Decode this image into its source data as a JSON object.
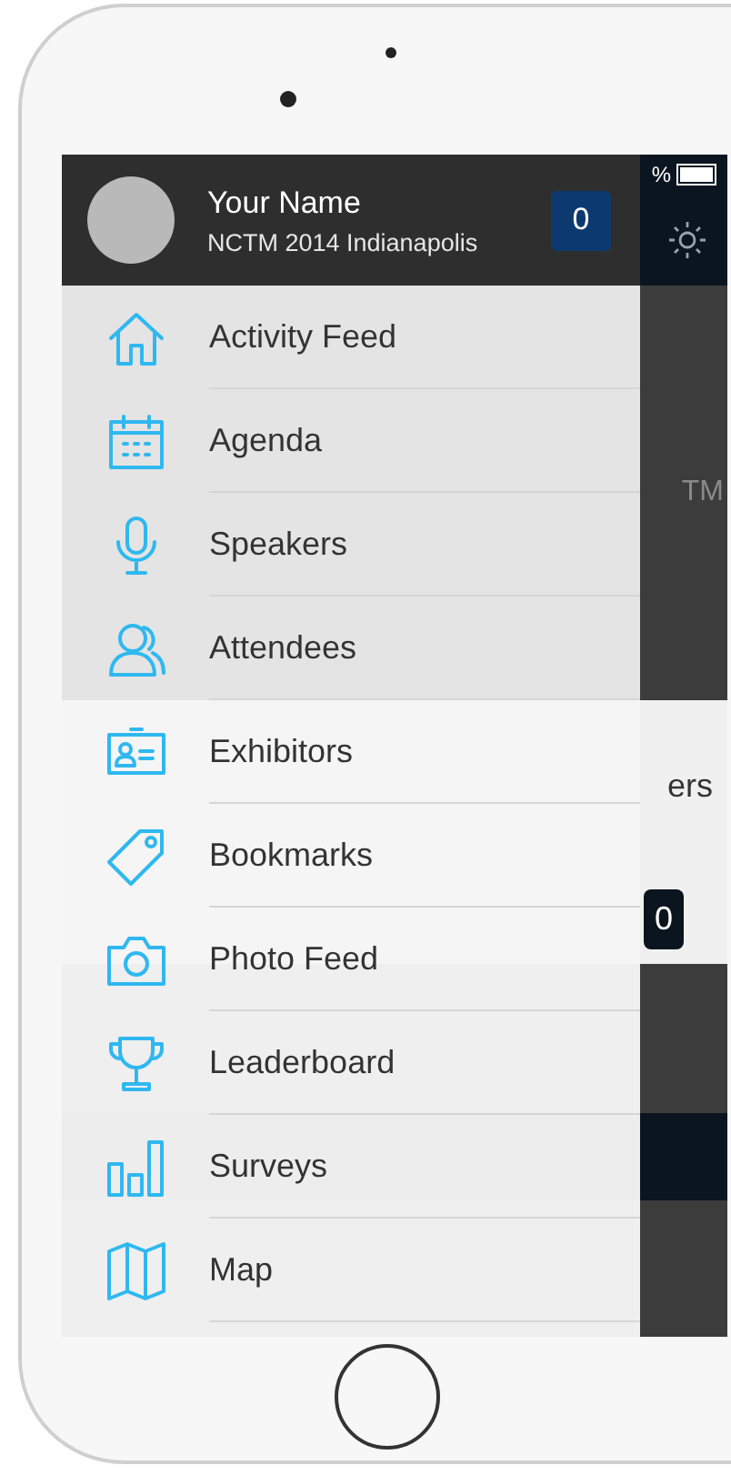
{
  "profile": {
    "name": "Your Name",
    "event": "NCTM 2014 Indianapolis",
    "count": "0"
  },
  "menu": [
    {
      "label": "Activity Feed",
      "kind": "home"
    },
    {
      "label": "Agenda",
      "kind": "calendar"
    },
    {
      "label": "Speakers",
      "kind": "microphone"
    },
    {
      "label": "Attendees",
      "kind": "people"
    },
    {
      "label": "Exhibitors",
      "kind": "badge"
    },
    {
      "label": "Bookmarks",
      "kind": "tag"
    },
    {
      "label": "Photo Feed",
      "kind": "camera"
    },
    {
      "label": "Leaderboard",
      "kind": "trophy"
    },
    {
      "label": "Surveys",
      "kind": "bars"
    },
    {
      "label": "Map",
      "kind": "map"
    }
  ],
  "background": {
    "status": "%",
    "title_fragment": "TM",
    "stat_fragment": "ers",
    "notification_count": "0"
  }
}
